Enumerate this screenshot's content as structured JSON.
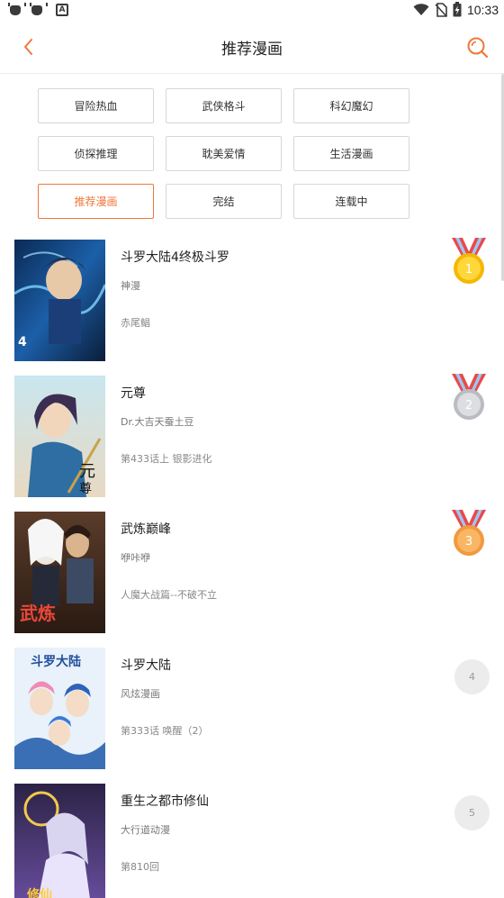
{
  "status_bar": {
    "time": "10:33",
    "icons": [
      "bug-icon",
      "bug-icon",
      "a-notification-icon",
      "wifi-icon",
      "no-sim-icon",
      "battery-charging-icon"
    ]
  },
  "header": {
    "title": "推荐漫画",
    "back_icon": "chevron-left-icon",
    "search_icon": "search-icon",
    "accent_color": "#f0773b"
  },
  "tags": [
    {
      "label": "冒险热血",
      "active": false
    },
    {
      "label": "武侠格斗",
      "active": false
    },
    {
      "label": "科幻魔幻",
      "active": false
    },
    {
      "label": "侦探推理",
      "active": false
    },
    {
      "label": "耽美爱情",
      "active": false
    },
    {
      "label": "生活漫画",
      "active": false
    },
    {
      "label": "推荐漫画",
      "active": true
    },
    {
      "label": "完结",
      "active": false
    },
    {
      "label": "连载中",
      "active": false
    }
  ],
  "comics": [
    {
      "title": "斗罗大陆4终极斗罗",
      "author": "神漫",
      "chapter": "赤尾鲳",
      "rank": "1",
      "rank_type": "gold-medal"
    },
    {
      "title": "元尊",
      "author": "Dr.大吉天蚕土豆",
      "chapter": "第433话上 银影进化",
      "rank": "2",
      "rank_type": "silver-medal"
    },
    {
      "title": "武炼巅峰",
      "author": "咿咔咿",
      "chapter": "人魔大战篇--不破不立",
      "rank": "3",
      "rank_type": "bronze-medal"
    },
    {
      "title": "斗罗大陆",
      "author": "风炫漫画",
      "chapter": "第333话 唤醒（2）",
      "rank": "4",
      "rank_type": "plain"
    },
    {
      "title": "重生之都市修仙",
      "author": "大行道动漫",
      "chapter": "第810回",
      "rank": "5",
      "rank_type": "plain"
    }
  ]
}
